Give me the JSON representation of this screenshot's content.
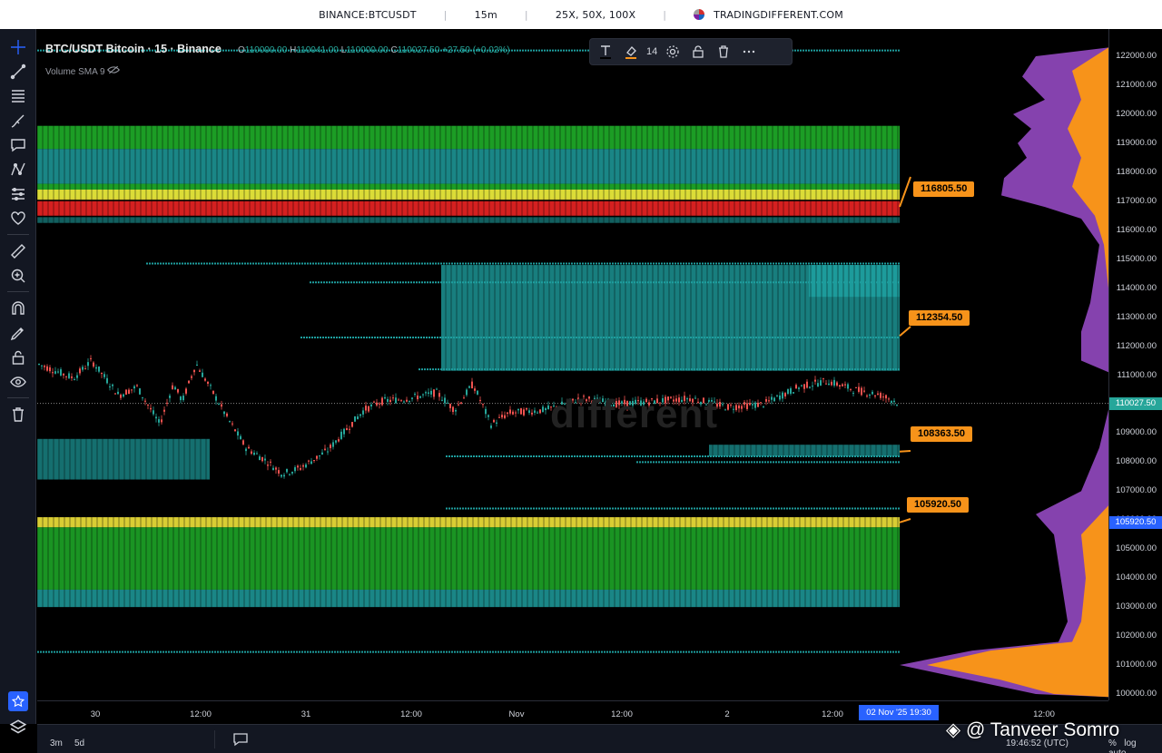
{
  "topbar": {
    "symbol": "BINANCE:BTCUSDT",
    "interval": "15m",
    "leverages": "25X, 50X, 100X",
    "site": "TRADINGDIFFERENT.COM"
  },
  "legend": {
    "title": "BTC/USDT Bitcoin · 15 · Binance",
    "o_label": "O",
    "o": "110000.00",
    "h_label": "H",
    "h": "110041.00",
    "l_label": "L",
    "l": "110000.00",
    "c_label": "C",
    "c": "110027.50",
    "change": "+27.50 (+0.02%)",
    "volume_sma": "Volume SMA 9"
  },
  "draw_toolbar": {
    "line_width": "14"
  },
  "levels": [
    {
      "id": "level-116805",
      "label": "116805.50"
    },
    {
      "id": "level-112354",
      "label": "112354.50"
    },
    {
      "id": "level-108363",
      "label": "108363.50"
    },
    {
      "id": "level-105920",
      "label": "105920.50"
    }
  ],
  "price_axis": {
    "ticks": [
      "122000.00",
      "121000.00",
      "120000.00",
      "119000.00",
      "118000.00",
      "117000.00",
      "116000.00",
      "115000.00",
      "114000.00",
      "113000.00",
      "112000.00",
      "111000.00",
      "110000.00",
      "109000.00",
      "108000.00",
      "107000.00",
      "106000.00",
      "105000.00",
      "104000.00",
      "103000.00",
      "102000.00",
      "101000.00",
      "100000.00"
    ],
    "last_price": "110027.50",
    "marker_price": "105920.50",
    "last_price_color": "#26a69a",
    "marker_color": "#2962ff"
  },
  "time_axis": {
    "ticks": [
      "30",
      "12:00",
      "31",
      "12:00",
      "Nov",
      "12:00",
      "2",
      "12:00",
      "12:00"
    ],
    "cursor_label": "02 Nov '25   19:30"
  },
  "bottom": {
    "range_3m": "3m",
    "range_5d": "5d",
    "clock": "19:46:52 (UTC)",
    "pct": "%",
    "log": "log",
    "auto": "auto"
  },
  "watermark": {
    "text": "@ Tanveer Somro",
    "center": "different"
  },
  "colors": {
    "accent": "#2962ff",
    "level_label": "#f7931a",
    "heat_green": "#1fae29",
    "heat_teal": "#1e9e9e",
    "heat_yellow": "#f1e33a",
    "heat_red": "#e02222",
    "profile_orange": "#f7931a",
    "profile_purple": "#9c4dcc"
  },
  "icons": [
    "crosshair-icon",
    "trend-line-icon",
    "fib-icon",
    "brush-icon",
    "text-icon",
    "pattern-icon",
    "measure-icon",
    "heart-icon",
    "ruler-icon",
    "zoom-icon",
    "magnet-icon",
    "lock-draw-icon",
    "lock-icon",
    "eye-icon",
    "trash-icon",
    "star-icon",
    "layers-icon"
  ]
}
